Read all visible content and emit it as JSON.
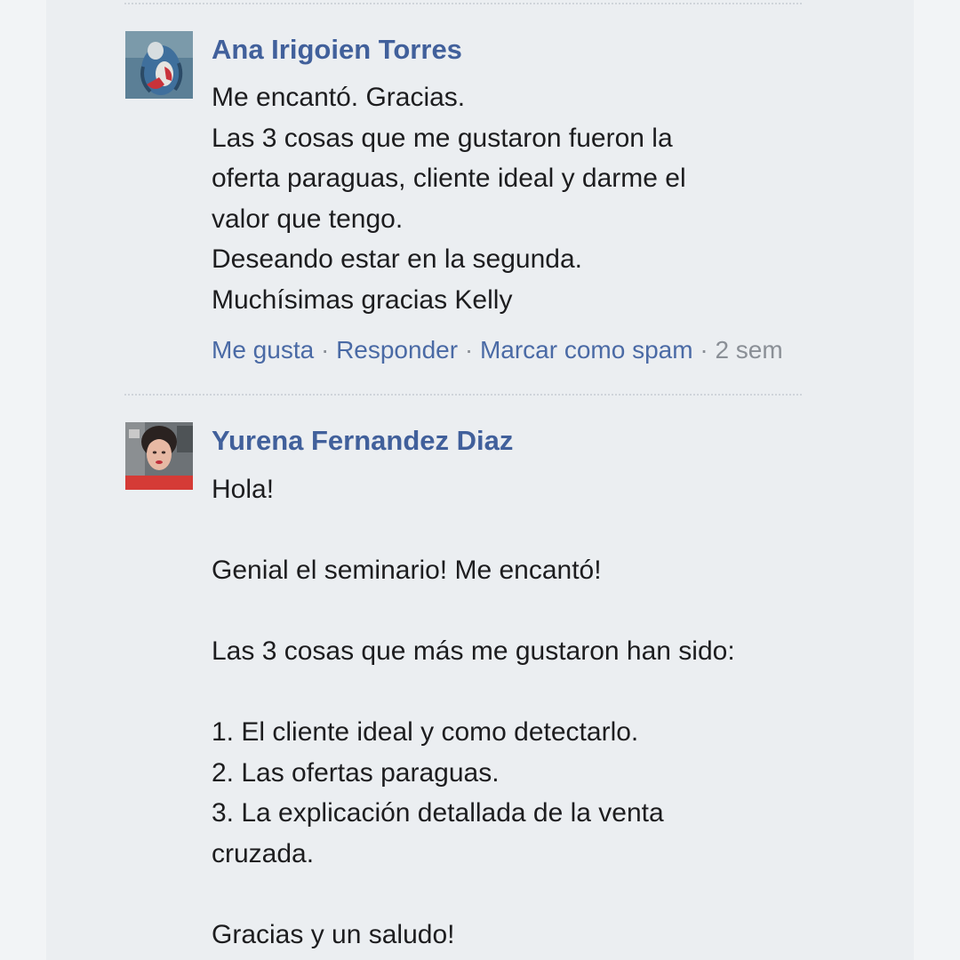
{
  "comments": [
    {
      "author": "Ana Irigoien Torres",
      "avatar_icon": "painting-avatar",
      "lines": [
        "Me encantó. Gracias.",
        "Las 3 cosas que me gustaron fueron la",
        "oferta paraguas, cliente ideal y darme el",
        "valor que tengo.",
        "Deseando estar en la segunda.",
        "Muchísimas gracias Kelly"
      ],
      "actions": {
        "like": "Me gusta",
        "reply": "Responder",
        "spam": "Marcar como spam",
        "separator": "·",
        "time": "2 sem"
      }
    },
    {
      "author": "Yurena Fernandez Diaz",
      "avatar_icon": "photo-avatar",
      "lines": [
        "Hola!",
        "",
        "Genial el seminario! Me encantó!",
        "",
        "Las 3 cosas que más me gustaron han sido:",
        "",
        "1. El cliente ideal y como detectarlo.",
        "2. Las ofertas paraguas.",
        "3. La explicación detallada de la venta",
        "cruzada.",
        "",
        "Gracias y un saludo!"
      ]
    }
  ],
  "colors": {
    "author": "#41609b",
    "link": "#4a6aa5",
    "muted": "#8a8f96",
    "text": "#1d1d1f"
  }
}
